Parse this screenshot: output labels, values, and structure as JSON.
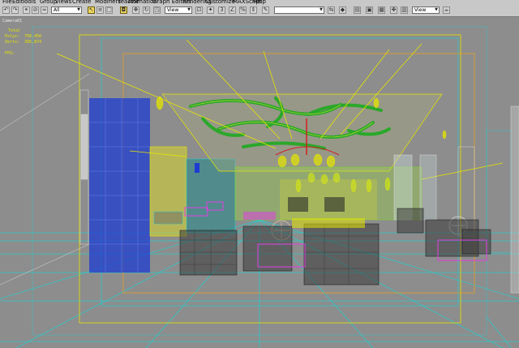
{
  "menu": {
    "items": [
      "File",
      "Edit",
      "Tools",
      "Group",
      "Views",
      "Create",
      "Modifiers",
      "reactor",
      "Animation",
      "Graph Editors",
      "Rendering",
      "Customize",
      "MAXScript",
      "Help"
    ]
  },
  "toolbar": {
    "selection_filter": "All",
    "coord_system": "View",
    "named_selection": "",
    "render_view": "View"
  },
  "viewport": {
    "label": "Camera01",
    "stats_title": "Total",
    "stats_polys": "Polys:  756,456",
    "stats_verts": "Verts:  395,874",
    "fps": "FPS:"
  },
  "colors": {
    "bg": "#8d8d8d",
    "grid": "#2ec8c8",
    "ceiling_green": "#2aa82a",
    "yellow": "#e6e600",
    "blue_wall": "#1e3cd2",
    "furniture": "#3a3a3a"
  }
}
